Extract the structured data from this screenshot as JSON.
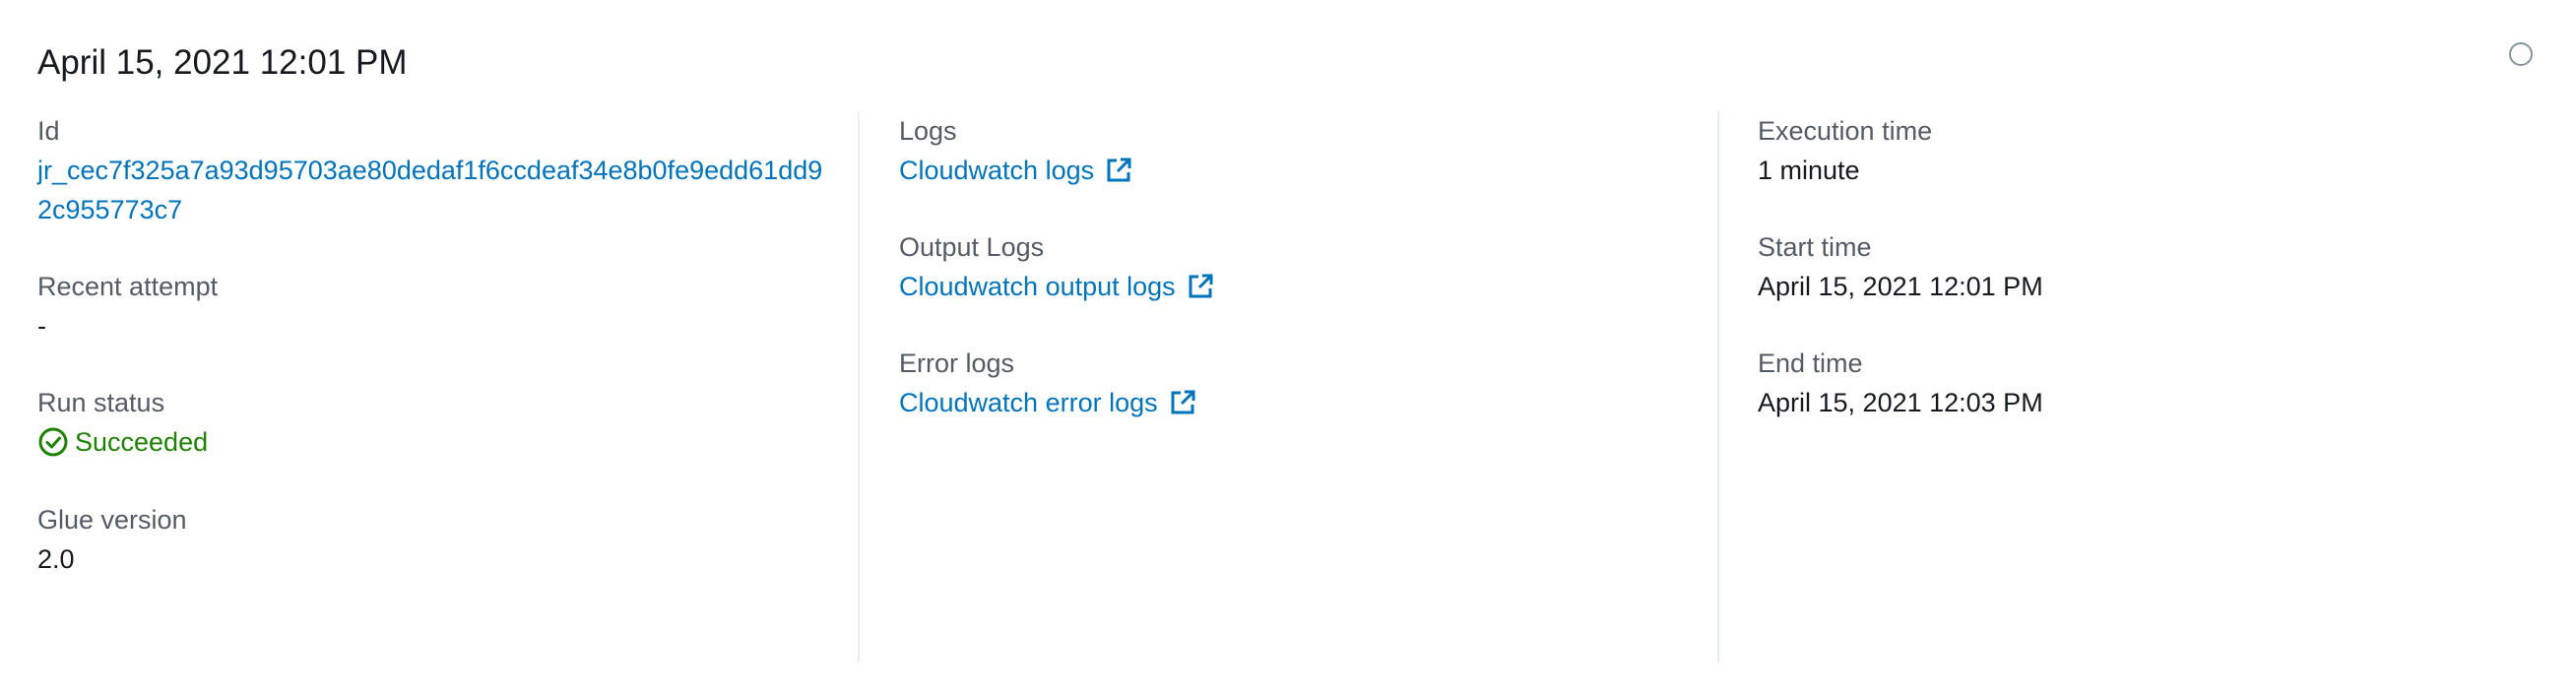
{
  "header": {
    "title": "April 15, 2021 12:01 PM"
  },
  "details": {
    "id": {
      "label": "Id",
      "value": "jr_cec7f325a7a93d95703ae80dedaf1f6ccdeaf34e8b0fe9edd61dd92c955773c7"
    },
    "recent_attempt": {
      "label": "Recent attempt",
      "value": "-"
    },
    "run_status": {
      "label": "Run status",
      "value": "Succeeded",
      "icon": "check-circle-icon",
      "color": "#1d8102"
    },
    "glue_version": {
      "label": "Glue version",
      "value": "2.0"
    },
    "logs": {
      "label": "Logs",
      "link_text": "Cloudwatch logs",
      "icon": "external-link-icon"
    },
    "output_logs": {
      "label": "Output Logs",
      "link_text": "Cloudwatch output logs",
      "icon": "external-link-icon"
    },
    "error_logs": {
      "label": "Error logs",
      "link_text": "Cloudwatch error logs",
      "icon": "external-link-icon"
    },
    "execution_time": {
      "label": "Execution time",
      "value": "1 minute"
    },
    "start_time": {
      "label": "Start time",
      "value": "April 15, 2021 12:01 PM"
    },
    "end_time": {
      "label": "End time",
      "value": "April 15, 2021 12:03 PM"
    }
  },
  "colors": {
    "link": "#0073bb",
    "label": "#545b64",
    "text": "#16191f",
    "success": "#1d8102",
    "divider": "#eaeded"
  }
}
